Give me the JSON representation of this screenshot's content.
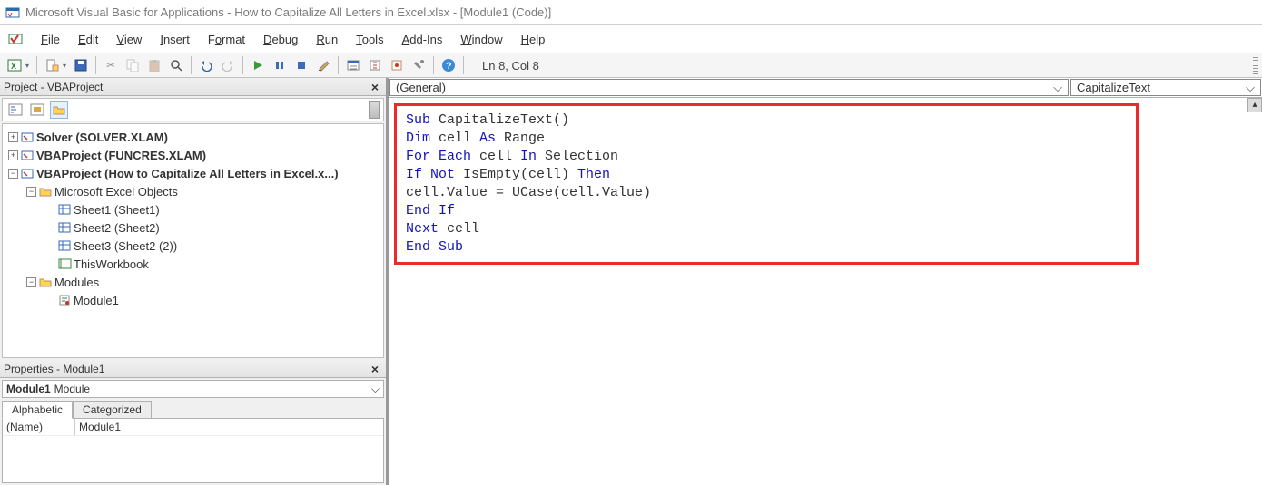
{
  "title": "Microsoft Visual Basic for Applications - How to Capitalize All Letters in Excel.xlsx - [Module1 (Code)]",
  "menu": {
    "file": "File",
    "edit": "Edit",
    "view": "View",
    "insert": "Insert",
    "format": "Format",
    "debug": "Debug",
    "run": "Run",
    "tools": "Tools",
    "addins": "Add-Ins",
    "window": "Window",
    "help": "Help"
  },
  "toolbar_status": "Ln 8, Col 8",
  "project": {
    "title": "Project - VBAProject",
    "nodes": {
      "solver": "Solver (SOLVER.XLAM)",
      "funcres": "VBAProject (FUNCRES.XLAM)",
      "main": "VBAProject (How to Capitalize All Letters in Excel.x...)",
      "excel_objects": "Microsoft Excel Objects",
      "sheet1": "Sheet1 (Sheet1)",
      "sheet2": "Sheet2 (Sheet2)",
      "sheet3": "Sheet3 (Sheet2 (2))",
      "thiswb": "ThisWorkbook",
      "modules": "Modules",
      "module1": "Module1"
    }
  },
  "properties": {
    "title": "Properties - Module1",
    "obj_name": "Module1",
    "obj_type": "Module",
    "tabs": {
      "alpha": "Alphabetic",
      "cat": "Categorized"
    },
    "name_label": "(Name)",
    "name_value": "Module1"
  },
  "code": {
    "dd_general": "(General)",
    "dd_proc": "CapitalizeText",
    "tokens": [
      [
        {
          "t": "Sub",
          "k": true
        },
        {
          "t": " CapitalizeText()",
          "k": false
        }
      ],
      [
        {
          "t": "Dim",
          "k": true
        },
        {
          "t": " cell ",
          "k": false
        },
        {
          "t": "As",
          "k": true
        },
        {
          "t": " Range",
          "k": false
        }
      ],
      [
        {
          "t": "For Each",
          "k": true
        },
        {
          "t": " cell ",
          "k": false
        },
        {
          "t": "In",
          "k": true
        },
        {
          "t": " Selection",
          "k": false
        }
      ],
      [
        {
          "t": "If Not",
          "k": true
        },
        {
          "t": " IsEmpty(cell) ",
          "k": false
        },
        {
          "t": "Then",
          "k": true
        }
      ],
      [
        {
          "t": "cell.Value = UCase(cell.Value)",
          "k": false
        }
      ],
      [
        {
          "t": "End If",
          "k": true
        }
      ],
      [
        {
          "t": "Next",
          "k": true
        },
        {
          "t": " cell",
          "k": false
        }
      ],
      [
        {
          "t": "End Sub",
          "k": true
        }
      ]
    ]
  }
}
